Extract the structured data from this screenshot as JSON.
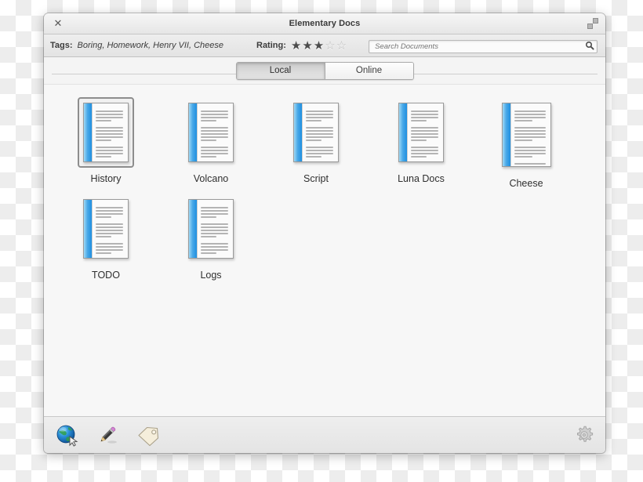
{
  "window": {
    "title": "Elementary Docs",
    "close_icon": "close-icon",
    "maximize_icon": "maximize-icon"
  },
  "toolbar": {
    "tags_label": "Tags:",
    "tags_value": "Boring, Homework, Henry VII, Cheese",
    "rating_label": "Rating:",
    "rating_value": 3,
    "rating_max": 5,
    "star_filled_glyph": "★",
    "star_empty_glyph": "☆",
    "search_placeholder": "Search Documents",
    "search_value": "",
    "search_icon": "search-icon"
  },
  "tabs": {
    "items": [
      {
        "label": "Local",
        "active": true
      },
      {
        "label": "Online",
        "active": false
      }
    ]
  },
  "documents": [
    {
      "name": "History",
      "selected": true,
      "size": "normal"
    },
    {
      "name": "Volcano",
      "selected": false,
      "size": "normal"
    },
    {
      "name": "Script",
      "selected": false,
      "size": "normal"
    },
    {
      "name": "Luna Docs",
      "selected": false,
      "size": "normal"
    },
    {
      "name": "Cheese",
      "selected": false,
      "size": "big"
    },
    {
      "name": "TODO",
      "selected": false,
      "size": "normal"
    },
    {
      "name": "Logs",
      "selected": false,
      "size": "normal"
    }
  ],
  "bottombar": {
    "buttons": [
      {
        "icon": "globe-web-icon",
        "title": "Web"
      },
      {
        "icon": "pencil-edit-icon",
        "title": "Edit"
      },
      {
        "icon": "tag-icon",
        "title": "Tags"
      }
    ],
    "settings": {
      "icon": "gear-icon",
      "title": "Settings"
    }
  },
  "colors": {
    "accent_blue": "#1f8fe0",
    "window_bg": "#f4f4f4",
    "content_bg": "#f7f7f7",
    "selection_border": "#8d8d8d"
  }
}
